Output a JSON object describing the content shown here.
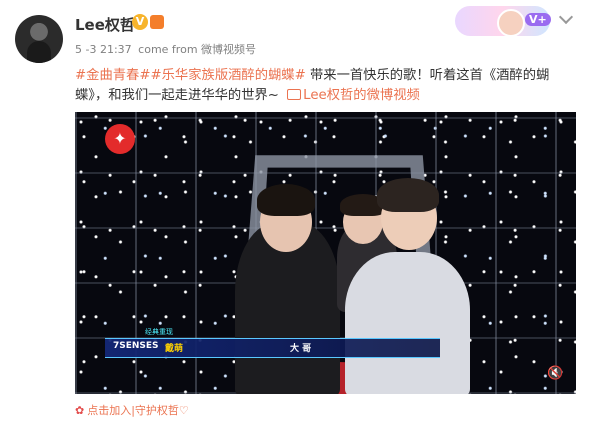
{
  "post": {
    "username": "Lee权哲",
    "verify_icon": "verified-badge-icon",
    "vip_icon": "vip-icon",
    "time": "5 -3 21:37",
    "source": "come from 微博视频号",
    "hashtag1": "#金曲青春#",
    "hashtag2": "#乐华家族版酒醉的蝴蝶#",
    "body": " 带来一首快乐的歌！听着这首《酒醉的蝴蝶》，和我们一起走进华华的世界~ ",
    "video_link": "Lee权哲的微博视频",
    "support_text": "点击加入|守护权哲♡"
  },
  "video": {
    "channel_logo": "✦",
    "caption_tag": "经典重现",
    "group": "7SENSES",
    "member": "戴萌",
    "role": "大 哥",
    "mute_icon": "mute-icon"
  },
  "colors": {
    "link": "#eb7350",
    "meta": "#808080",
    "caption_bar": "#142878",
    "member_highlight": "#ffd200"
  }
}
